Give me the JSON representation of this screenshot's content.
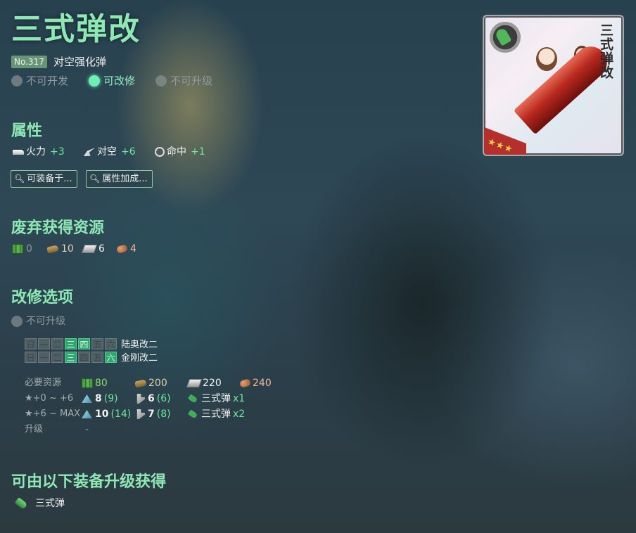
{
  "equip": {
    "name": "三式弹改",
    "number": "No.317",
    "type": "对空强化弹",
    "flags": [
      {
        "label": "不可开发",
        "state": "off"
      },
      {
        "label": "可改修",
        "state": "on"
      },
      {
        "label": "不可升级",
        "state": "off"
      }
    ],
    "card_title": "三式弹改"
  },
  "stats": {
    "heading": "属性",
    "items": [
      {
        "icon": "firepower-icon",
        "label": "火力",
        "value": "+3"
      },
      {
        "icon": "anti-air-icon",
        "label": "对空",
        "value": "+6"
      },
      {
        "icon": "accuracy-icon",
        "label": "命中",
        "value": "+1"
      }
    ],
    "buttons": [
      {
        "label": "可装备于..."
      },
      {
        "label": "属性加成..."
      }
    ]
  },
  "scrap": {
    "heading": "废弃获得资源",
    "fuel": "0",
    "ammo": "10",
    "steel": "6",
    "bauxite": "4"
  },
  "improvement": {
    "heading": "改修选项",
    "upgrade_status": "不可升级",
    "days": [
      "日",
      "一",
      "二",
      "三",
      "四",
      "五",
      "六"
    ],
    "schedules": [
      {
        "ship": "陆奥改二",
        "active": [
          false,
          false,
          false,
          true,
          true,
          false,
          false
        ]
      },
      {
        "ship": "金刚改二",
        "active": [
          false,
          false,
          false,
          true,
          false,
          false,
          true
        ]
      }
    ],
    "required_label": "必要资源",
    "required": {
      "fuel": "80",
      "ammo": "200",
      "steel": "220",
      "bauxite": "240"
    },
    "tiers": [
      {
        "label": "★+0 ~ +6",
        "devmat": "8",
        "devmat_sure": "(9)",
        "screw": "6",
        "screw_sure": "(6)",
        "item": "三式弹",
        "item_qty": "x1"
      },
      {
        "label": "★+6 ~ MAX",
        "devmat": "10",
        "devmat_sure": "(14)",
        "screw": "7",
        "screw_sure": "(8)",
        "item": "三式弹",
        "item_qty": "x2"
      }
    ],
    "upgrade_label": "升级",
    "upgrade_value": "-"
  },
  "source": {
    "heading": "可由以下装备升级获得",
    "items": [
      {
        "name": "三式弹"
      }
    ]
  },
  "colors": {
    "heading": "#8ee8b4",
    "stat_value": "#6ee89a",
    "day_active": "#2ea870",
    "background": "#2e4856"
  }
}
